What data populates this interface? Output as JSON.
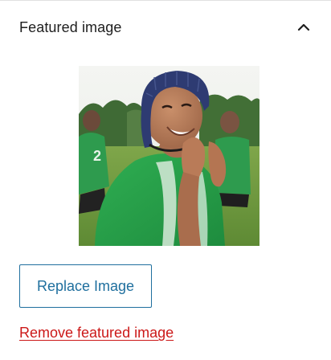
{
  "panel": {
    "title": "Featured image",
    "collapse_icon": "chevron-up-icon",
    "image_alt": "Smiling rugby player in a green jersey wearing a navy scrum cap on a grass field",
    "replace_label": "Replace Image",
    "remove_label": "Remove featured image"
  },
  "colors": {
    "title_text": "#1e1e1e",
    "accent": "#1f6f9e",
    "destructive": "#cc1818",
    "divider": "#e0e0e0"
  }
}
